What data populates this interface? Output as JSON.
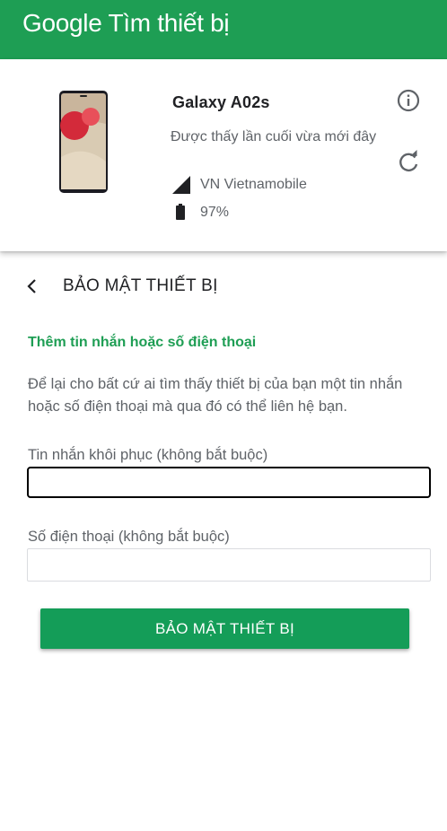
{
  "header": {
    "title": "Google Tìm thiết bị"
  },
  "device": {
    "name": "Galaxy A02s",
    "last_seen": "Được thấy lần cuối vừa mới đây",
    "carrier": "VN Vietnamobile",
    "battery": "97%"
  },
  "section": {
    "title": "BẢO MẬT THIẾT BỊ",
    "subheading": "Thêm tin nhắn hoặc số điện thoại",
    "description": "Để lại cho bất cứ ai tìm thấy thiết bị của bạn một tin nhắn hoặc số điện thoại mà qua đó có thể liên hệ bạn.",
    "message_label": "Tin nhắn khôi phục (không bắt buộc)",
    "message_value": "",
    "phone_label": "Số điện thoại (không bắt buộc)",
    "phone_value": "",
    "button_label": "BẢO MẬT THIẾT BỊ"
  },
  "colors": {
    "brand": "#1e9e54",
    "button": "#149d58"
  },
  "icons": [
    "info-icon",
    "refresh-icon",
    "back-arrow-icon",
    "signal-icon",
    "battery-icon"
  ]
}
